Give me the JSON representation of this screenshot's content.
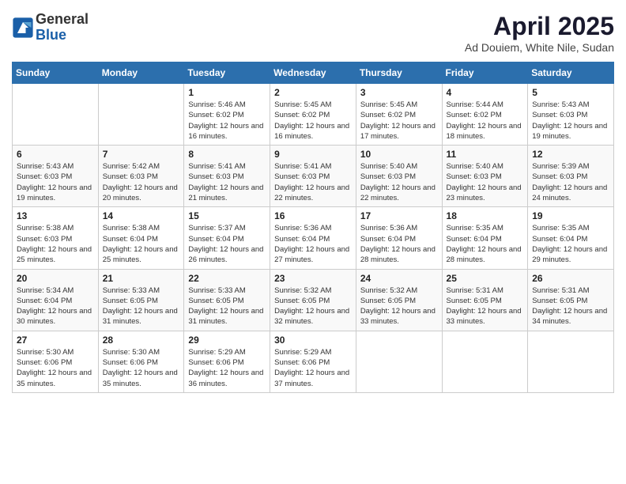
{
  "logo": {
    "general": "General",
    "blue": "Blue"
  },
  "header": {
    "month": "April 2025",
    "location": "Ad Douiem, White Nile, Sudan"
  },
  "weekdays": [
    "Sunday",
    "Monday",
    "Tuesday",
    "Wednesday",
    "Thursday",
    "Friday",
    "Saturday"
  ],
  "weeks": [
    [
      {
        "day": "",
        "info": ""
      },
      {
        "day": "",
        "info": ""
      },
      {
        "day": "1",
        "info": "Sunrise: 5:46 AM\nSunset: 6:02 PM\nDaylight: 12 hours and 16 minutes."
      },
      {
        "day": "2",
        "info": "Sunrise: 5:45 AM\nSunset: 6:02 PM\nDaylight: 12 hours and 16 minutes."
      },
      {
        "day": "3",
        "info": "Sunrise: 5:45 AM\nSunset: 6:02 PM\nDaylight: 12 hours and 17 minutes."
      },
      {
        "day": "4",
        "info": "Sunrise: 5:44 AM\nSunset: 6:02 PM\nDaylight: 12 hours and 18 minutes."
      },
      {
        "day": "5",
        "info": "Sunrise: 5:43 AM\nSunset: 6:03 PM\nDaylight: 12 hours and 19 minutes."
      }
    ],
    [
      {
        "day": "6",
        "info": "Sunrise: 5:43 AM\nSunset: 6:03 PM\nDaylight: 12 hours and 19 minutes."
      },
      {
        "day": "7",
        "info": "Sunrise: 5:42 AM\nSunset: 6:03 PM\nDaylight: 12 hours and 20 minutes."
      },
      {
        "day": "8",
        "info": "Sunrise: 5:41 AM\nSunset: 6:03 PM\nDaylight: 12 hours and 21 minutes."
      },
      {
        "day": "9",
        "info": "Sunrise: 5:41 AM\nSunset: 6:03 PM\nDaylight: 12 hours and 22 minutes."
      },
      {
        "day": "10",
        "info": "Sunrise: 5:40 AM\nSunset: 6:03 PM\nDaylight: 12 hours and 22 minutes."
      },
      {
        "day": "11",
        "info": "Sunrise: 5:40 AM\nSunset: 6:03 PM\nDaylight: 12 hours and 23 minutes."
      },
      {
        "day": "12",
        "info": "Sunrise: 5:39 AM\nSunset: 6:03 PM\nDaylight: 12 hours and 24 minutes."
      }
    ],
    [
      {
        "day": "13",
        "info": "Sunrise: 5:38 AM\nSunset: 6:03 PM\nDaylight: 12 hours and 25 minutes."
      },
      {
        "day": "14",
        "info": "Sunrise: 5:38 AM\nSunset: 6:04 PM\nDaylight: 12 hours and 25 minutes."
      },
      {
        "day": "15",
        "info": "Sunrise: 5:37 AM\nSunset: 6:04 PM\nDaylight: 12 hours and 26 minutes."
      },
      {
        "day": "16",
        "info": "Sunrise: 5:36 AM\nSunset: 6:04 PM\nDaylight: 12 hours and 27 minutes."
      },
      {
        "day": "17",
        "info": "Sunrise: 5:36 AM\nSunset: 6:04 PM\nDaylight: 12 hours and 28 minutes."
      },
      {
        "day": "18",
        "info": "Sunrise: 5:35 AM\nSunset: 6:04 PM\nDaylight: 12 hours and 28 minutes."
      },
      {
        "day": "19",
        "info": "Sunrise: 5:35 AM\nSunset: 6:04 PM\nDaylight: 12 hours and 29 minutes."
      }
    ],
    [
      {
        "day": "20",
        "info": "Sunrise: 5:34 AM\nSunset: 6:04 PM\nDaylight: 12 hours and 30 minutes."
      },
      {
        "day": "21",
        "info": "Sunrise: 5:33 AM\nSunset: 6:05 PM\nDaylight: 12 hours and 31 minutes."
      },
      {
        "day": "22",
        "info": "Sunrise: 5:33 AM\nSunset: 6:05 PM\nDaylight: 12 hours and 31 minutes."
      },
      {
        "day": "23",
        "info": "Sunrise: 5:32 AM\nSunset: 6:05 PM\nDaylight: 12 hours and 32 minutes."
      },
      {
        "day": "24",
        "info": "Sunrise: 5:32 AM\nSunset: 6:05 PM\nDaylight: 12 hours and 33 minutes."
      },
      {
        "day": "25",
        "info": "Sunrise: 5:31 AM\nSunset: 6:05 PM\nDaylight: 12 hours and 33 minutes."
      },
      {
        "day": "26",
        "info": "Sunrise: 5:31 AM\nSunset: 6:05 PM\nDaylight: 12 hours and 34 minutes."
      }
    ],
    [
      {
        "day": "27",
        "info": "Sunrise: 5:30 AM\nSunset: 6:06 PM\nDaylight: 12 hours and 35 minutes."
      },
      {
        "day": "28",
        "info": "Sunrise: 5:30 AM\nSunset: 6:06 PM\nDaylight: 12 hours and 35 minutes."
      },
      {
        "day": "29",
        "info": "Sunrise: 5:29 AM\nSunset: 6:06 PM\nDaylight: 12 hours and 36 minutes."
      },
      {
        "day": "30",
        "info": "Sunrise: 5:29 AM\nSunset: 6:06 PM\nDaylight: 12 hours and 37 minutes."
      },
      {
        "day": "",
        "info": ""
      },
      {
        "day": "",
        "info": ""
      },
      {
        "day": "",
        "info": ""
      }
    ]
  ]
}
